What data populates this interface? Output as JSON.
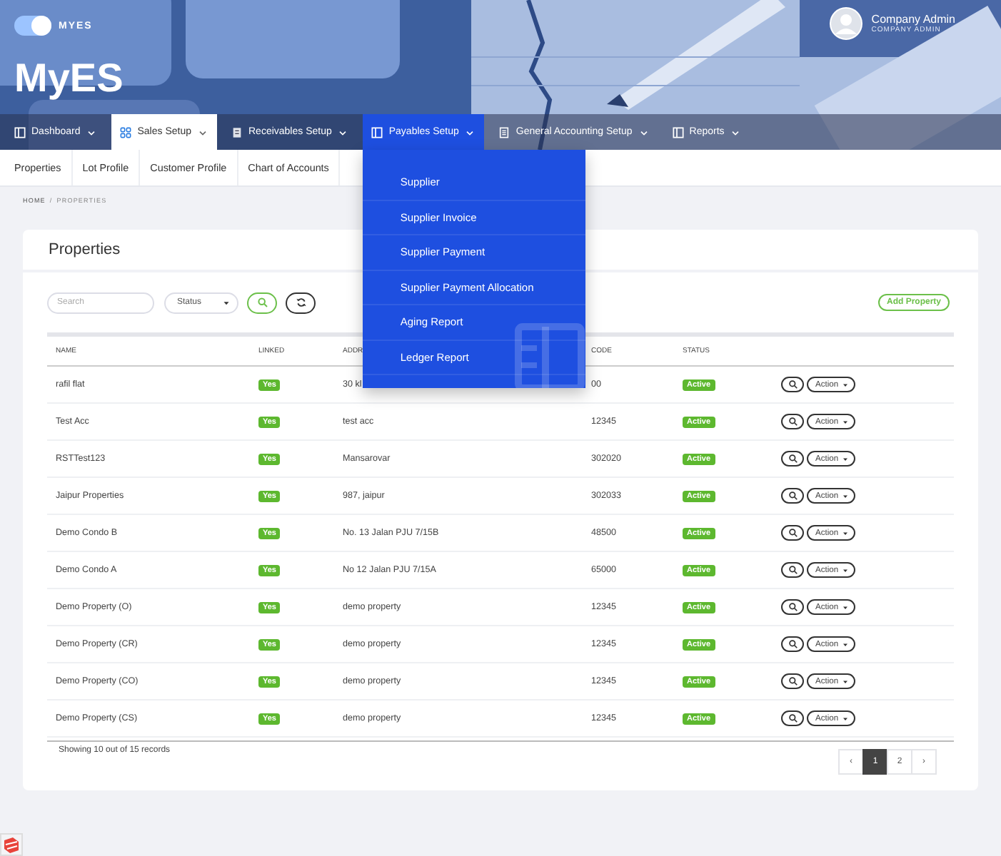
{
  "brand": {
    "logo_text": "MYES",
    "title": "MyES"
  },
  "user": {
    "name": "Company Admin",
    "role": "COMPANY ADMIN"
  },
  "nav": [
    {
      "label": "Dashboard",
      "selected": false,
      "expanded": false
    },
    {
      "label": "Sales Setup",
      "selected": true,
      "expanded": false
    },
    {
      "label": "Receivables Setup",
      "selected": false,
      "expanded": false
    },
    {
      "label": "Payables Setup",
      "selected": false,
      "expanded": true
    },
    {
      "label": "General Accounting Setup",
      "selected": false,
      "expanded": false
    },
    {
      "label": "Reports",
      "selected": false,
      "expanded": false
    }
  ],
  "dropdown": [
    "Supplier",
    "Supplier Invoice",
    "Supplier Payment",
    "Supplier Payment Allocation",
    "Aging Report",
    "Ledger Report"
  ],
  "subnav": [
    "Properties",
    "Lot Profile",
    "Customer Profile",
    "Chart of Accounts"
  ],
  "breadcrumb": [
    "HOME",
    "/",
    "PROPERTIES"
  ],
  "card": {
    "title": "Properties",
    "search": {
      "placeholder": "Search"
    },
    "status_filter": "Status",
    "add_button": "Add Property"
  },
  "table": {
    "columns": [
      "NAME",
      "LINKED",
      "ADDR",
      "CODE",
      "STATUS"
    ],
    "rows": [
      {
        "name": "rafil flat",
        "linked": "Yes",
        "address": "30 kl",
        "postcode": "00",
        "status": "Active",
        "action": "Action"
      },
      {
        "name": "Test Acc",
        "linked": "Yes",
        "address": "test acc",
        "postcode": "12345",
        "status": "Active",
        "action": "Action"
      },
      {
        "name": "RSTTest123",
        "linked": "Yes",
        "address": "Mansarovar",
        "postcode": "302020",
        "status": "Active",
        "action": "Action"
      },
      {
        "name": "Jaipur Properties",
        "linked": "Yes",
        "address": "987, jaipur",
        "postcode": "302033",
        "status": "Active",
        "action": "Action"
      },
      {
        "name": "Demo Condo B",
        "linked": "Yes",
        "address": "No. 13 Jalan PJU 7/15B",
        "postcode": "48500",
        "status": "Active",
        "action": "Action"
      },
      {
        "name": "Demo Condo A",
        "linked": "Yes",
        "address": "No 12 Jalan PJU 7/15A",
        "postcode": "65000",
        "status": "Active",
        "action": "Action"
      },
      {
        "name": "Demo Property (O)",
        "linked": "Yes",
        "address": "demo property",
        "postcode": "12345",
        "status": "Active",
        "action": "Action"
      },
      {
        "name": "Demo Property (CR)",
        "linked": "Yes",
        "address": "demo property",
        "postcode": "12345",
        "status": "Active",
        "action": "Action"
      },
      {
        "name": "Demo Property (CO)",
        "linked": "Yes",
        "address": "demo property",
        "postcode": "12345",
        "status": "Active",
        "action": "Action"
      },
      {
        "name": "Demo Property (CS)",
        "linked": "Yes",
        "address": "demo property",
        "postcode": "12345",
        "status": "Active",
        "action": "Action"
      }
    ],
    "summary": "Showing 10 out of 15 records"
  },
  "pagination": [
    {
      "label": "‹",
      "selected": false
    },
    {
      "label": "1",
      "selected": true
    },
    {
      "label": "2",
      "selected": false
    },
    {
      "label": "›",
      "selected": false
    }
  ]
}
